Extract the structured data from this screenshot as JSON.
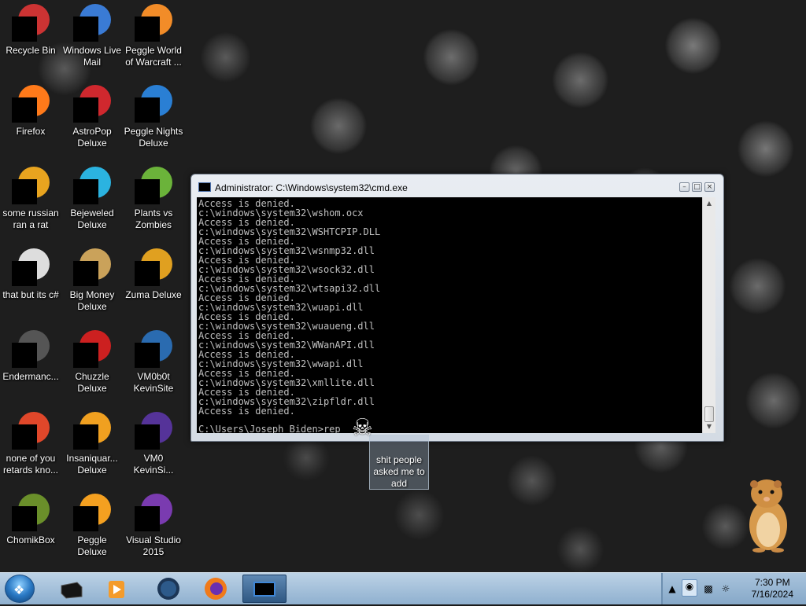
{
  "desktop": {
    "icons": [
      {
        "label": "Recycle Bin"
      },
      {
        "label": "Windows Live Mail"
      },
      {
        "label": "Peggle World of Warcraft ..."
      },
      {
        "label": "Firefox"
      },
      {
        "label": "AstroPop Deluxe"
      },
      {
        "label": "Peggle Nights Deluxe"
      },
      {
        "label": "some russian ran a rat"
      },
      {
        "label": "Bejeweled Deluxe"
      },
      {
        "label": "Plants vs Zombies"
      },
      {
        "label": "that but its c#"
      },
      {
        "label": "Big Money Deluxe"
      },
      {
        "label": "Zuma Deluxe"
      },
      {
        "label": "Endermanc..."
      },
      {
        "label": "Chuzzle Deluxe"
      },
      {
        "label": "VM0b0t KevinSite"
      },
      {
        "label": "none of you retards kno..."
      },
      {
        "label": "Insaniquar... Deluxe"
      },
      {
        "label": "VM0 KevinSi..."
      },
      {
        "label": "ChomikBox"
      },
      {
        "label": "Peggle Deluxe"
      },
      {
        "label": "Visual Studio 2015"
      }
    ],
    "dragged_item": {
      "label": "shit people asked me to add"
    }
  },
  "cmd_window": {
    "title": "Administrator: C:\\Windows\\system32\\cmd.exe",
    "lines": [
      "Access is denied.",
      "c:\\windows\\system32\\wshom.ocx",
      "Access is denied.",
      "c:\\windows\\system32\\WSHTCPIP.DLL",
      "Access is denied.",
      "c:\\windows\\system32\\wsnmp32.dll",
      "Access is denied.",
      "c:\\windows\\system32\\wsock32.dll",
      "Access is denied.",
      "c:\\windows\\system32\\wtsapi32.dll",
      "Access is denied.",
      "c:\\windows\\system32\\wuapi.dll",
      "Access is denied.",
      "c:\\windows\\system32\\wuaueng.dll",
      "Access is denied.",
      "c:\\windows\\system32\\WWanAPI.dll",
      "Access is denied.",
      "c:\\windows\\system32\\wwapi.dll",
      "Access is denied.",
      "c:\\windows\\system32\\xmllite.dll",
      "Access is denied.",
      "c:\\windows\\system32\\zipfldr.dll",
      "Access is denied."
    ],
    "prompt": "C:\\Users\\Joseph Biden>rep"
  },
  "taskbar": {
    "clock_time": "7:30 PM",
    "clock_date": "7/16/2024"
  }
}
